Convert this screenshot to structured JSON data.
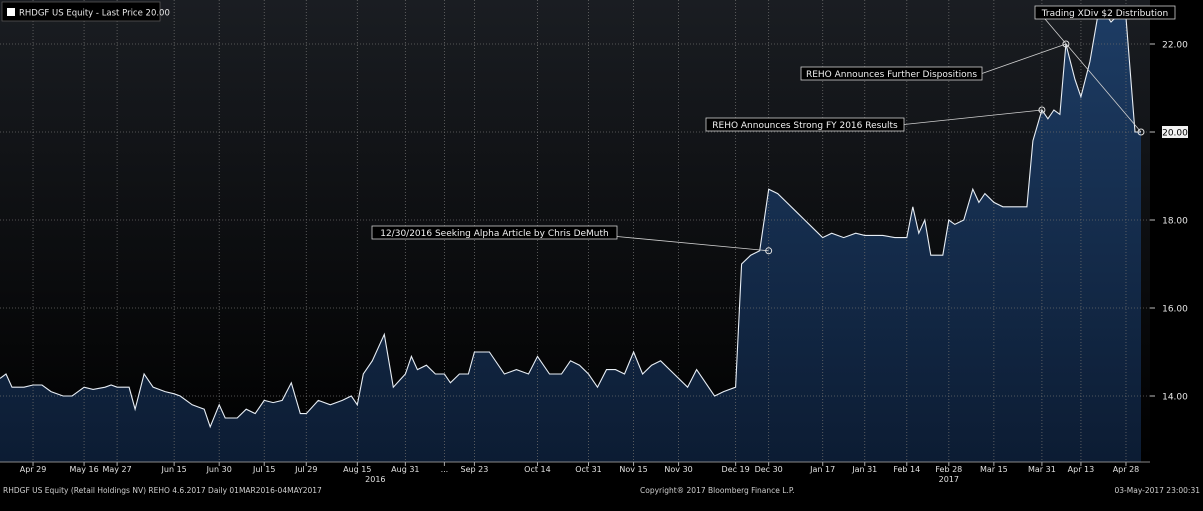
{
  "chart_data": {
    "type": "area",
    "legend_label": "RHDGF US Equity - Last Price 20.00",
    "colors": {
      "background": "#000000",
      "plot_bg_top": "#1a1d22",
      "line": "#e8eef5",
      "fill_top": "#1d3c64",
      "fill_bottom": "#0c1c33",
      "grid": "#6a6a6a",
      "last_price_box": "#f2f2f2"
    },
    "ylim": [
      12.5,
      23.0
    ],
    "ytick_labels": [
      "14.00",
      "16.00",
      "18.00",
      "20.00",
      "22.00"
    ],
    "last_price_label": "20.00",
    "x_range": [
      "2016-04-18",
      "2017-05-06"
    ],
    "xticks": [
      {
        "date": "2016-04-29",
        "label": "Apr 29"
      },
      {
        "date": "2016-05-16",
        "label": "May 16"
      },
      {
        "date": "2016-05-27",
        "label": "May 27"
      },
      {
        "date": "2016-06-15",
        "label": "Jun 15"
      },
      {
        "date": "2016-06-30",
        "label": "Jun 30"
      },
      {
        "date": "2016-07-15",
        "label": "Jul 15"
      },
      {
        "date": "2016-07-29",
        "label": "Jul 29"
      },
      {
        "date": "2016-08-15",
        "label": "Aug 15"
      },
      {
        "date": "2016-08-31",
        "label": "Aug 31"
      },
      {
        "date": "2016-09-13",
        "label": "..."
      },
      {
        "date": "2016-09-23",
        "label": "Sep 23"
      },
      {
        "date": "2016-10-14",
        "label": "Oct 14"
      },
      {
        "date": "2016-10-31",
        "label": "Oct 31"
      },
      {
        "date": "2016-11-15",
        "label": "Nov 15"
      },
      {
        "date": "2016-11-30",
        "label": "Nov 30"
      },
      {
        "date": "2016-12-19",
        "label": "Dec 19"
      },
      {
        "date": "2016-12-30",
        "label": "Dec 30"
      },
      {
        "date": "2017-01-17",
        "label": "Jan 17"
      },
      {
        "date": "2017-01-31",
        "label": "Jan 31"
      },
      {
        "date": "2017-02-14",
        "label": "Feb 14"
      },
      {
        "date": "2017-02-28",
        "label": "Feb 28"
      },
      {
        "date": "2017-03-15",
        "label": "Mar 15"
      },
      {
        "date": "2017-03-31",
        "label": "Mar 31"
      },
      {
        "date": "2017-04-13",
        "label": "Apr 13"
      },
      {
        "date": "2017-04-28",
        "label": "Apr 28"
      }
    ],
    "year_labels": [
      {
        "date": "2016-08-21",
        "label": "2016"
      },
      {
        "date": "2017-02-28",
        "label": "2017"
      }
    ],
    "series": [
      {
        "values": [
          [
            "2016-04-18",
            14.4
          ],
          [
            "2016-04-20",
            14.5
          ],
          [
            "2016-04-22",
            14.2
          ],
          [
            "2016-04-26",
            14.2
          ],
          [
            "2016-04-29",
            14.25
          ],
          [
            "2016-05-02",
            14.25
          ],
          [
            "2016-05-05",
            14.1
          ],
          [
            "2016-05-09",
            14.0
          ],
          [
            "2016-05-12",
            14.0
          ],
          [
            "2016-05-16",
            14.2
          ],
          [
            "2016-05-19",
            14.15
          ],
          [
            "2016-05-23",
            14.2
          ],
          [
            "2016-05-25",
            14.25
          ],
          [
            "2016-05-27",
            14.2
          ],
          [
            "2016-05-31",
            14.2
          ],
          [
            "2016-06-02",
            13.7
          ],
          [
            "2016-06-05",
            14.5
          ],
          [
            "2016-06-08",
            14.2
          ],
          [
            "2016-06-12",
            14.1
          ],
          [
            "2016-06-15",
            14.05
          ],
          [
            "2016-06-17",
            14.0
          ],
          [
            "2016-06-21",
            13.8
          ],
          [
            "2016-06-23",
            13.75
          ],
          [
            "2016-06-25",
            13.7
          ],
          [
            "2016-06-27",
            13.3
          ],
          [
            "2016-06-30",
            13.8
          ],
          [
            "2016-07-02",
            13.5
          ],
          [
            "2016-07-06",
            13.5
          ],
          [
            "2016-07-09",
            13.7
          ],
          [
            "2016-07-12",
            13.6
          ],
          [
            "2016-07-15",
            13.9
          ],
          [
            "2016-07-18",
            13.85
          ],
          [
            "2016-07-21",
            13.9
          ],
          [
            "2016-07-24",
            14.3
          ],
          [
            "2016-07-27",
            13.6
          ],
          [
            "2016-07-29",
            13.6
          ],
          [
            "2016-08-02",
            13.9
          ],
          [
            "2016-08-06",
            13.8
          ],
          [
            "2016-08-10",
            13.9
          ],
          [
            "2016-08-13",
            14.0
          ],
          [
            "2016-08-15",
            13.8
          ],
          [
            "2016-08-17",
            14.5
          ],
          [
            "2016-08-20",
            14.8
          ],
          [
            "2016-08-24",
            15.4
          ],
          [
            "2016-08-27",
            14.2
          ],
          [
            "2016-08-31",
            14.5
          ],
          [
            "2016-09-02",
            14.9
          ],
          [
            "2016-09-04",
            14.6
          ],
          [
            "2016-09-07",
            14.7
          ],
          [
            "2016-09-10",
            14.5
          ],
          [
            "2016-09-13",
            14.5
          ],
          [
            "2016-09-15",
            14.3
          ],
          [
            "2016-09-18",
            14.5
          ],
          [
            "2016-09-21",
            14.5
          ],
          [
            "2016-09-23",
            15.0
          ],
          [
            "2016-09-28",
            15.0
          ],
          [
            "2016-10-03",
            14.5
          ],
          [
            "2016-10-07",
            14.6
          ],
          [
            "2016-10-11",
            14.5
          ],
          [
            "2016-10-14",
            14.9
          ],
          [
            "2016-10-18",
            14.5
          ],
          [
            "2016-10-22",
            14.5
          ],
          [
            "2016-10-25",
            14.8
          ],
          [
            "2016-10-28",
            14.7
          ],
          [
            "2016-10-31",
            14.5
          ],
          [
            "2016-11-03",
            14.2
          ],
          [
            "2016-11-06",
            14.6
          ],
          [
            "2016-11-09",
            14.6
          ],
          [
            "2016-11-12",
            14.5
          ],
          [
            "2016-11-15",
            15.0
          ],
          [
            "2016-11-18",
            14.5
          ],
          [
            "2016-11-21",
            14.7
          ],
          [
            "2016-11-24",
            14.8
          ],
          [
            "2016-11-27",
            14.6
          ],
          [
            "2016-11-30",
            14.4
          ],
          [
            "2016-12-03",
            14.2
          ],
          [
            "2016-12-06",
            14.6
          ],
          [
            "2016-12-09",
            14.3
          ],
          [
            "2016-12-12",
            14.0
          ],
          [
            "2016-12-15",
            14.1
          ],
          [
            "2016-12-19",
            14.2
          ],
          [
            "2016-12-21",
            17.0
          ],
          [
            "2016-12-24",
            17.2
          ],
          [
            "2016-12-27",
            17.3
          ],
          [
            "2016-12-30",
            18.7
          ],
          [
            "2017-01-02",
            18.6
          ],
          [
            "2017-01-05",
            18.4
          ],
          [
            "2017-01-08",
            18.2
          ],
          [
            "2017-01-11",
            18.0
          ],
          [
            "2017-01-14",
            17.8
          ],
          [
            "2017-01-17",
            17.6
          ],
          [
            "2017-01-20",
            17.7
          ],
          [
            "2017-01-24",
            17.6
          ],
          [
            "2017-01-28",
            17.7
          ],
          [
            "2017-01-31",
            17.65
          ],
          [
            "2017-02-06",
            17.65
          ],
          [
            "2017-02-10",
            17.6
          ],
          [
            "2017-02-14",
            17.6
          ],
          [
            "2017-02-16",
            18.3
          ],
          [
            "2017-02-18",
            17.7
          ],
          [
            "2017-02-20",
            18.0
          ],
          [
            "2017-02-22",
            17.2
          ],
          [
            "2017-02-26",
            17.2
          ],
          [
            "2017-02-28",
            18.0
          ],
          [
            "2017-03-02",
            17.9
          ],
          [
            "2017-03-05",
            18.0
          ],
          [
            "2017-03-08",
            18.7
          ],
          [
            "2017-03-10",
            18.4
          ],
          [
            "2017-03-12",
            18.6
          ],
          [
            "2017-03-15",
            18.4
          ],
          [
            "2017-03-18",
            18.3
          ],
          [
            "2017-03-21",
            18.3
          ],
          [
            "2017-03-24",
            18.3
          ],
          [
            "2017-03-26",
            18.3
          ],
          [
            "2017-03-28",
            19.8
          ],
          [
            "2017-03-31",
            20.5
          ],
          [
            "2017-04-02",
            20.3
          ],
          [
            "2017-04-04",
            20.5
          ],
          [
            "2017-04-06",
            20.4
          ],
          [
            "2017-04-08",
            22.0
          ],
          [
            "2017-04-11",
            21.2
          ],
          [
            "2017-04-13",
            20.8
          ],
          [
            "2017-04-16",
            21.6
          ],
          [
            "2017-04-19",
            22.8
          ],
          [
            "2017-04-21",
            22.7
          ],
          [
            "2017-04-23",
            22.5
          ],
          [
            "2017-04-26",
            22.7
          ],
          [
            "2017-04-28",
            22.6
          ],
          [
            "2017-05-01",
            20.0
          ],
          [
            "2017-05-03",
            20.0
          ]
        ]
      }
    ],
    "annotations": [
      {
        "text": "12/30/2016 Seeking Alpha Article by Chris DeMuth",
        "date": "2016-12-30",
        "value": 17.3
      },
      {
        "text": "REHO Announces Strong FY 2016 Results",
        "date": "2017-03-31",
        "value": 20.5
      },
      {
        "text": "REHO Announces Further Dispositions",
        "date": "2017-04-08",
        "value": 22.0
      },
      {
        "text": "Trading XDiv $2 Distribution",
        "date": "2017-05-03",
        "value": 20.0
      }
    ]
  },
  "footer": {
    "left": "RHDGF US Equity (Retail Holdings NV) REHO 4.6.2017  Daily 01MAR2016-04MAY2017",
    "center": "Copyright® 2017 Bloomberg Finance L.P.",
    "right": "03-May-2017 23:00:31"
  }
}
